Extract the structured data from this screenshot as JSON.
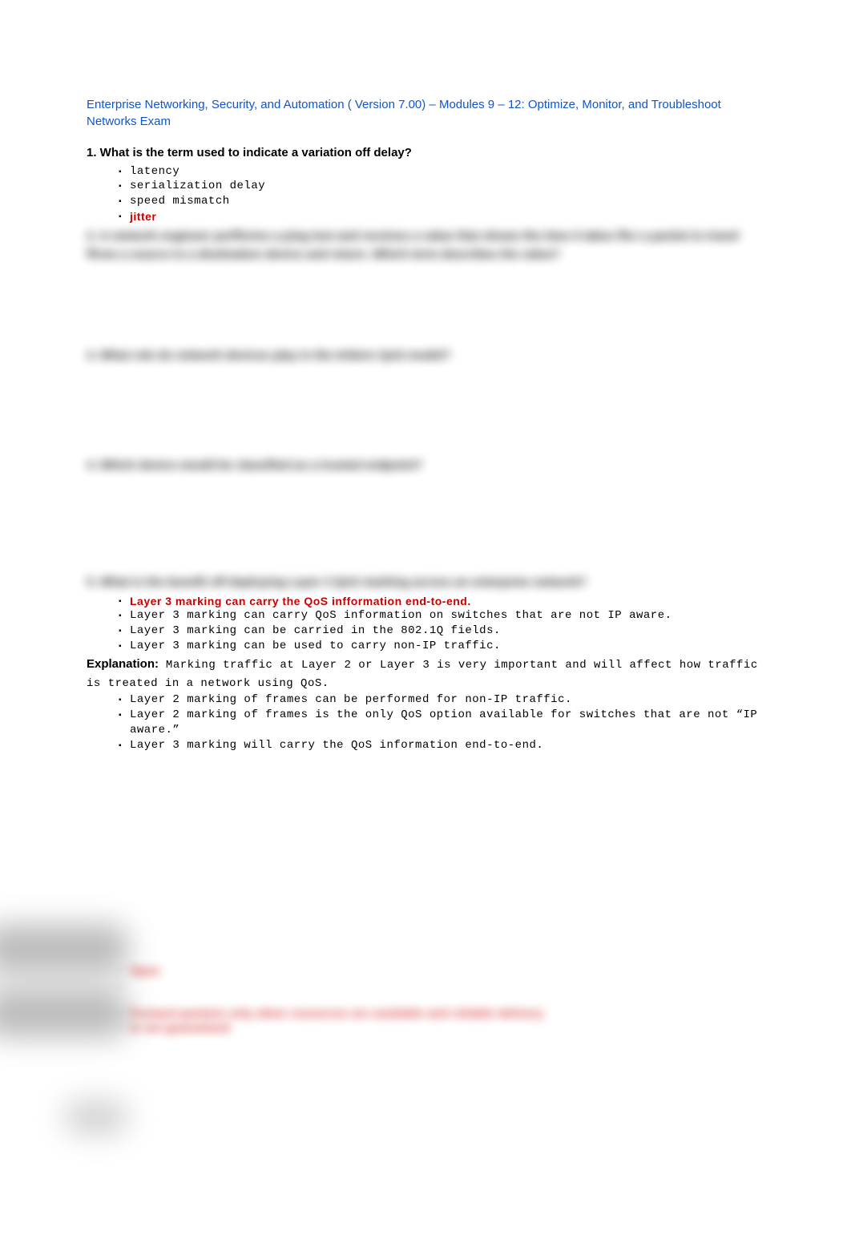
{
  "title": "Enterprise Networking, Security, and Automation ( Version 7.00) – Modules 9 – 12: Optimize, Monitor, and Troubleshoot Networks Exam",
  "q1": {
    "text": "1. What is the term used to indicate a variation off delay?",
    "opts": [
      "latency",
      "serialization delay",
      "speed mismatch",
      "jitter"
    ]
  },
  "q2": {
    "text": "2. A network engineer perfforms a ping test and receives a value that shows the time it takes ffor a packet to travel ffrom a source to a destination device and return. Which term describes the value?"
  },
  "q3": {
    "text": "3. What role do network devices play in the IntServ QoS model?"
  },
  "q4": {
    "text": "4. Which device would be classified as a trusted endpoint?"
  },
  "q5": {
    "text": "5. What is the benefit off deploying Layer 3 QoS marking across an enterprise network?",
    "correct": "Layer 3 marking can carry the QoS infformation end-to-end.",
    "opts": [
      "Layer 3 marking can carry QoS information on switches that are not IP aware.",
      "Layer 3 marking can be carried in the 802.1Q fields.",
      "Layer 3 marking can be used to carry non-IP traffic."
    ],
    "exp_label": "Explanation:",
    "exp_text": " Marking traffic at Layer 2 or Layer 3 is very important and will affect how traffic is treated in a network using QoS.",
    "sub": [
      "Layer 2 marking of frames can be performed for non-IP traffic.",
      "Layer 2 marking of frames is the only QoS option available for switches that are not “IP aware.”",
      "Layer 3 marking will carry the QoS information end-to-end."
    ]
  },
  "blur6": {
    "opts": [
      "",
      "Open",
      "",
      ""
    ],
    "corr1": "Forward packets only when resources are available and reliable delivery",
    "corr2": "is not guaranteed"
  }
}
